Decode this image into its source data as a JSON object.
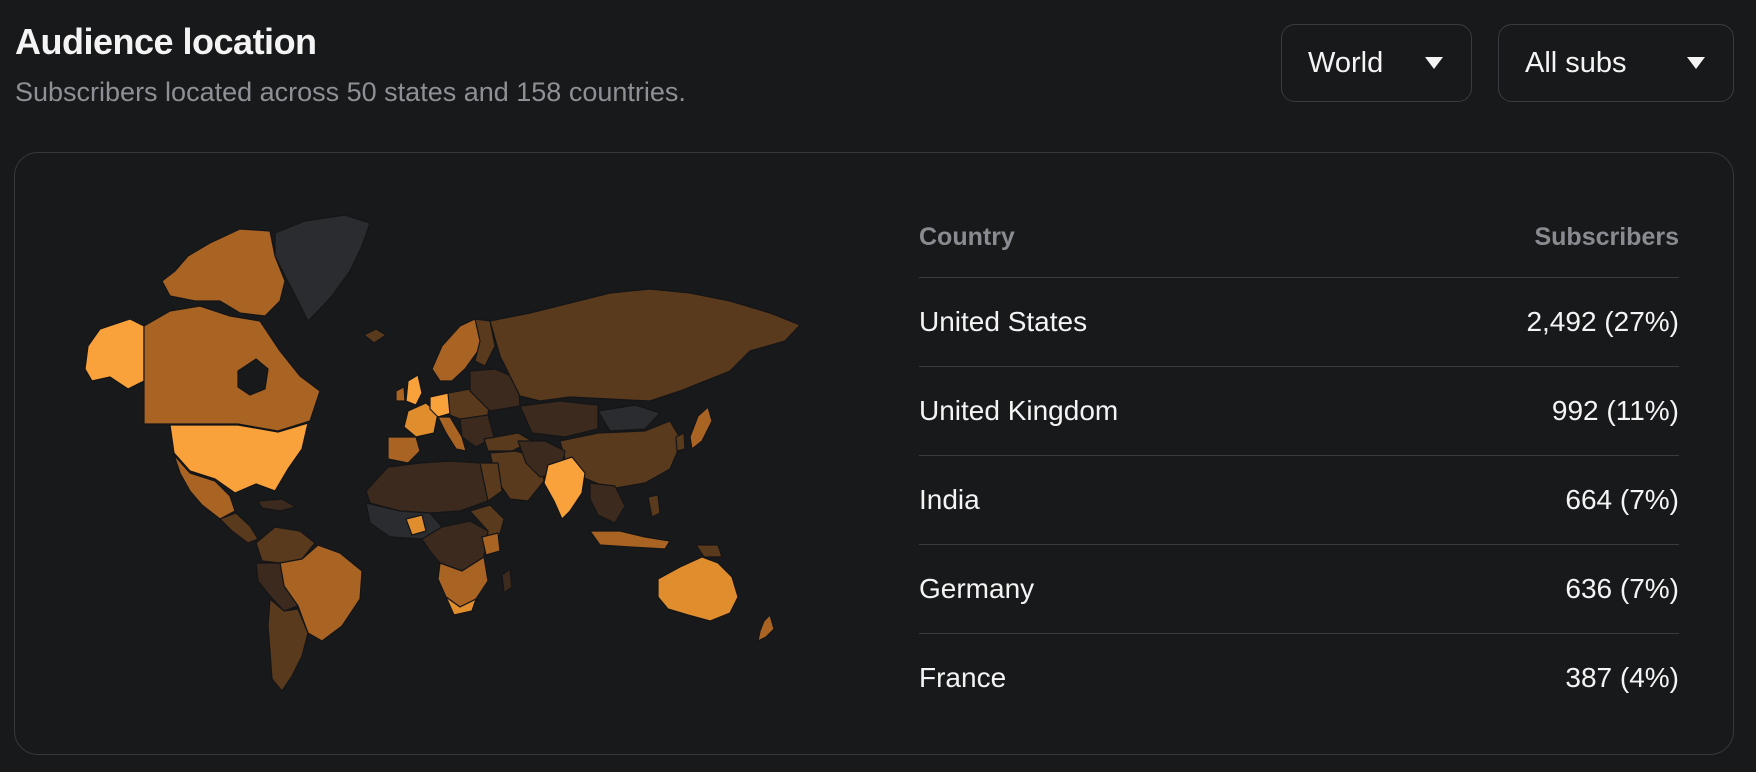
{
  "header": {
    "title": "Audience location",
    "subtitle": "Subscribers located across 50 states and 158 countries."
  },
  "filters": {
    "region": {
      "selected": "World",
      "icon": "caret-down-icon"
    },
    "audience": {
      "selected": "All subs",
      "icon": "caret-down-icon"
    }
  },
  "table": {
    "col_country": "Country",
    "col_subscribers": "Subscribers",
    "rows": [
      {
        "country": "United States",
        "subscribers": "2,492 (27%)"
      },
      {
        "country": "United Kingdom",
        "subscribers": "992 (11%)"
      },
      {
        "country": "India",
        "subscribers": "664 (7%)"
      },
      {
        "country": "Germany",
        "subscribers": "636 (7%)"
      },
      {
        "country": "France",
        "subscribers": "387 (4%)"
      }
    ]
  },
  "map": {
    "legend_colors": {
      "highest": "#f9a23b",
      "high": "#e08d2e",
      "medium": "#a96424",
      "low": "#5a3a1d",
      "lowest": "#3b2a1d",
      "none": "#2b2c2f"
    }
  }
}
